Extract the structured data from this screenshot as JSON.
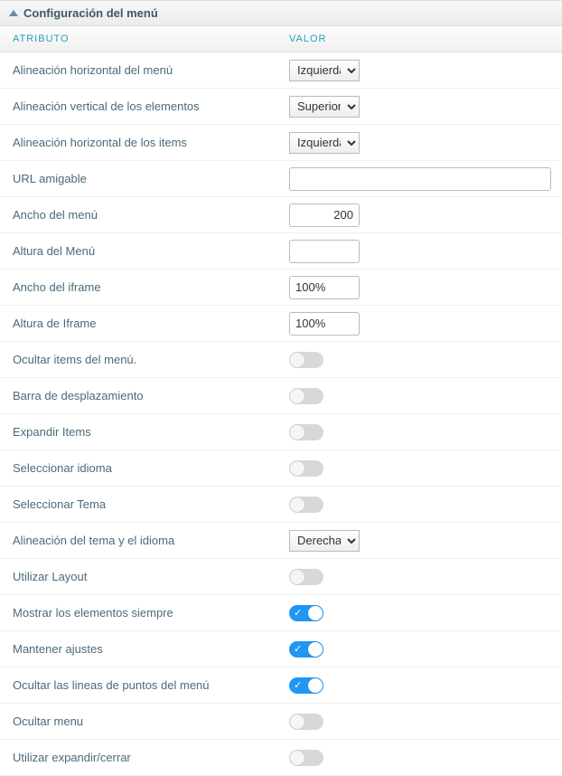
{
  "section_title": "Configuración del menú",
  "headers": {
    "attr": "ATRIBUTO",
    "val": "VALOR"
  },
  "rows": {
    "halign_menu": {
      "label": "Alineación horizontal del menú",
      "type": "select",
      "value": "Izquierda"
    },
    "valign_items": {
      "label": "Alineación vertical de los elementos",
      "type": "select",
      "value": "Superior"
    },
    "halign_items": {
      "label": "Alineación horizontal de los items",
      "type": "select",
      "value": "Izquierda"
    },
    "friendly_url": {
      "label": "URL amigable",
      "type": "text_full",
      "value": ""
    },
    "menu_width": {
      "label": "Ancho del menú",
      "type": "text_num",
      "value": "200"
    },
    "menu_height": {
      "label": "Altura del Menú",
      "type": "text_sm",
      "value": ""
    },
    "iframe_width": {
      "label": "Ancho del iframe",
      "type": "text_sm",
      "value": "100%"
    },
    "iframe_height": {
      "label": "Altura de Iframe",
      "type": "text_sm",
      "value": "100%"
    },
    "hide_items": {
      "label": "Ocultar items del menú.",
      "type": "toggle",
      "value": false
    },
    "scrollbar": {
      "label": "Barra de desplazamiento",
      "type": "toggle",
      "value": false
    },
    "expand_items": {
      "label": "Expandir Items",
      "type": "toggle",
      "value": false
    },
    "select_lang": {
      "label": "Seleccionar idioma",
      "type": "toggle",
      "value": false
    },
    "select_theme": {
      "label": "Seleccionar Tema",
      "type": "toggle",
      "value": false
    },
    "theme_lang_align": {
      "label": "Alineación del tema y el idioma",
      "type": "select",
      "value": "Derecha"
    },
    "use_layout": {
      "label": "Utilizar Layout",
      "type": "toggle",
      "value": false
    },
    "always_show": {
      "label": "Mostrar los elementos siempre",
      "type": "toggle",
      "value": true
    },
    "keep_settings": {
      "label": "Mantener ajustes",
      "type": "toggle",
      "value": true
    },
    "hide_dotted": {
      "label": "Ocultar las lineas de puntos del menú",
      "type": "toggle",
      "value": true
    },
    "hide_menu": {
      "label": "Ocultar menu",
      "type": "toggle",
      "value": false
    },
    "expand_close": {
      "label": "Utilizar expandir/cerrar",
      "type": "toggle",
      "value": false
    }
  },
  "row_order": [
    "halign_menu",
    "valign_items",
    "halign_items",
    "friendly_url",
    "menu_width",
    "menu_height",
    "iframe_width",
    "iframe_height",
    "hide_items",
    "scrollbar",
    "expand_items",
    "select_lang",
    "select_theme",
    "theme_lang_align",
    "use_layout",
    "always_show",
    "keep_settings",
    "hide_dotted",
    "hide_menu",
    "expand_close"
  ]
}
